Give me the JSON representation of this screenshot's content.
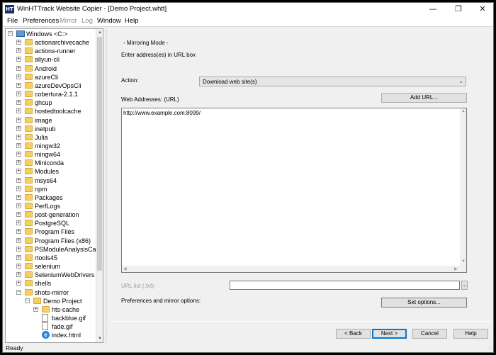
{
  "window": {
    "title": "WinHTTrack Website Copier - [Demo Project.whtt]",
    "icon_text": "HT",
    "controls": [
      "minimize-icon",
      "restore-icon",
      "close-icon"
    ]
  },
  "menu": [
    "File",
    "Preferences",
    "Mirror",
    "Log",
    "Window",
    "Help"
  ],
  "menu_disabled": [
    false,
    false,
    true,
    true,
    false,
    false
  ],
  "tree": {
    "items": [
      {
        "label": "Windows <C:>",
        "depth": 0,
        "icon": "computer-icon",
        "expander": "−"
      },
      {
        "label": "actionarchivecache",
        "depth": 1,
        "icon": "folder-icon",
        "expander": "+"
      },
      {
        "label": "actions-runner",
        "depth": 1,
        "icon": "folder-icon",
        "expander": "+"
      },
      {
        "label": "aliyun-cli",
        "depth": 1,
        "icon": "folder-icon",
        "expander": "+"
      },
      {
        "label": "Android",
        "depth": 1,
        "icon": "folder-icon",
        "expander": "+"
      },
      {
        "label": "azureCli",
        "depth": 1,
        "icon": "folder-icon",
        "expander": "+"
      },
      {
        "label": "azureDevOpsCli",
        "depth": 1,
        "icon": "folder-icon",
        "expander": "+"
      },
      {
        "label": "cobertura-2.1.1",
        "depth": 1,
        "icon": "folder-icon",
        "expander": "+"
      },
      {
        "label": "ghcup",
        "depth": 1,
        "icon": "folder-icon",
        "expander": "+"
      },
      {
        "label": "hostedtoolcache",
        "depth": 1,
        "icon": "folder-icon",
        "expander": "+"
      },
      {
        "label": "image",
        "depth": 1,
        "icon": "folder-icon",
        "expander": "+"
      },
      {
        "label": "inetpub",
        "depth": 1,
        "icon": "folder-icon",
        "expander": "+"
      },
      {
        "label": "Julia",
        "depth": 1,
        "icon": "folder-icon",
        "expander": "+"
      },
      {
        "label": "mingw32",
        "depth": 1,
        "icon": "folder-icon",
        "expander": "+"
      },
      {
        "label": "mingw64",
        "depth": 1,
        "icon": "folder-icon",
        "expander": "+"
      },
      {
        "label": "Miniconda",
        "depth": 1,
        "icon": "folder-icon",
        "expander": "+"
      },
      {
        "label": "Modules",
        "depth": 1,
        "icon": "folder-icon",
        "expander": "+"
      },
      {
        "label": "msys64",
        "depth": 1,
        "icon": "folder-icon",
        "expander": "+"
      },
      {
        "label": "npm",
        "depth": 1,
        "icon": "folder-icon",
        "expander": "+"
      },
      {
        "label": "Packages",
        "depth": 1,
        "icon": "folder-icon",
        "expander": "+"
      },
      {
        "label": "PerfLogs",
        "depth": 1,
        "icon": "folder-icon",
        "expander": "+"
      },
      {
        "label": "post-generation",
        "depth": 1,
        "icon": "folder-icon",
        "expander": "+"
      },
      {
        "label": "PostgreSQL",
        "depth": 1,
        "icon": "folder-icon",
        "expander": "+"
      },
      {
        "label": "Program Files",
        "depth": 1,
        "icon": "folder-icon",
        "expander": "+"
      },
      {
        "label": "Program Files (x86)",
        "depth": 1,
        "icon": "folder-icon",
        "expander": "+"
      },
      {
        "label": "PSModuleAnalysisCach",
        "depth": 1,
        "icon": "folder-icon",
        "expander": "+"
      },
      {
        "label": "rtools45",
        "depth": 1,
        "icon": "folder-icon",
        "expander": "+"
      },
      {
        "label": "selenium",
        "depth": 1,
        "icon": "folder-icon",
        "expander": "+"
      },
      {
        "label": "SeleniumWebDrivers",
        "depth": 1,
        "icon": "folder-icon",
        "expander": "+"
      },
      {
        "label": "shells",
        "depth": 1,
        "icon": "folder-icon",
        "expander": "+"
      },
      {
        "label": "shots-mirror",
        "depth": 1,
        "icon": "folder-icon",
        "expander": "−"
      },
      {
        "label": "Demo Project",
        "depth": 2,
        "icon": "folder-icon",
        "expander": "−"
      },
      {
        "label": "hts-cache",
        "depth": 3,
        "icon": "folder-icon",
        "expander": "+"
      },
      {
        "label": "backblue.gif",
        "depth": 3,
        "icon": "file-icon",
        "expander": ""
      },
      {
        "label": "fade.gif",
        "depth": 3,
        "icon": "file-icon",
        "expander": ""
      },
      {
        "label": "index.html",
        "depth": 3,
        "icon": "ie-icon",
        "expander": ""
      }
    ]
  },
  "panel": {
    "mode_heading": "- Mirroring Mode -",
    "instruction": "Enter address(es) in URL box",
    "action_label": "Action:",
    "action_value": "Download web site(s)",
    "web_addresses_label": "Web Addresses: (URL)",
    "add_url_button": "Add URL...",
    "url_text": "http://www.example.com:8099/",
    "url_list_label": "URL list (.txt):",
    "browse_button": "...",
    "prefs_label": "Preferences and mirror options:",
    "set_options_button": "Set options..."
  },
  "nav": {
    "back": "< Back",
    "next": "Next >",
    "cancel": "Cancel",
    "help": "Help"
  },
  "status": "Ready"
}
